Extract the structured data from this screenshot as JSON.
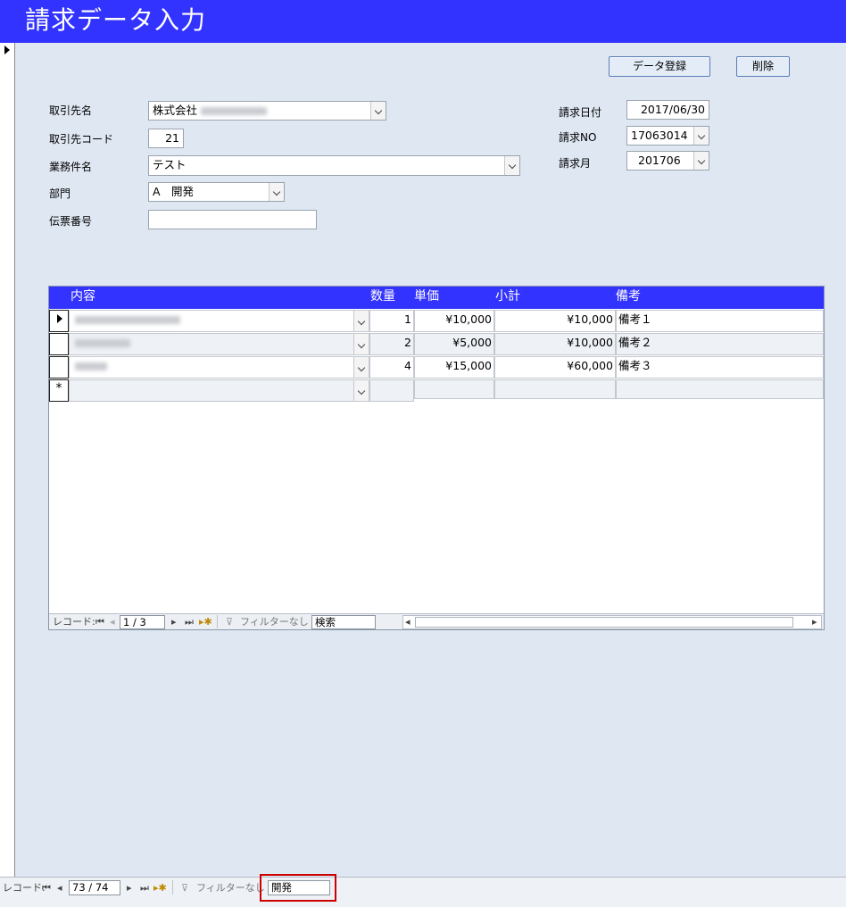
{
  "window": {
    "title": "請求データ入力"
  },
  "toolbar": {
    "register_label": "データ登録",
    "delete_label": "削除"
  },
  "form": {
    "client_name_label": "取引先名",
    "client_name_value": "株式会社",
    "client_code_label": "取引先コード",
    "client_code_value": "21",
    "project_label": "業務件名",
    "project_value": "テスト",
    "dept_label": "部門",
    "dept_value": "A　開発",
    "slip_label": "伝票番号",
    "slip_value": "",
    "invoice_date_label": "請求日付",
    "invoice_date_value": "2017/06/30",
    "invoice_no_label": "請求NO",
    "invoice_no_value": "17063014",
    "invoice_month_label": "請求月",
    "invoice_month_value": "201706"
  },
  "subform": {
    "headers": {
      "content": "内容",
      "qty": "数量",
      "unit_price": "単価",
      "subtotal": "小計",
      "note": "備考"
    },
    "rows": [
      {
        "qty": "1",
        "unit_price": "¥10,000",
        "subtotal": "¥10,000",
        "note": "備考１"
      },
      {
        "qty": "2",
        "unit_price": "¥5,000",
        "subtotal": "¥10,000",
        "note": "備考２"
      },
      {
        "qty": "4",
        "unit_price": "¥15,000",
        "subtotal": "¥60,000",
        "note": "備考３"
      }
    ],
    "new_row_marker": "*",
    "nav": {
      "record_label": "レコード:",
      "position": "1 / 3",
      "filter_label": "フィルターなし",
      "search_label": "検索"
    }
  },
  "main_nav": {
    "record_label": "レコード:",
    "position": "73 / 74",
    "filter_label": "フィルターなし",
    "search_value": "開発"
  },
  "colors": {
    "accent": "#3333ff",
    "form_bg": "#dfe7f3",
    "highlight": "#cc0000"
  }
}
